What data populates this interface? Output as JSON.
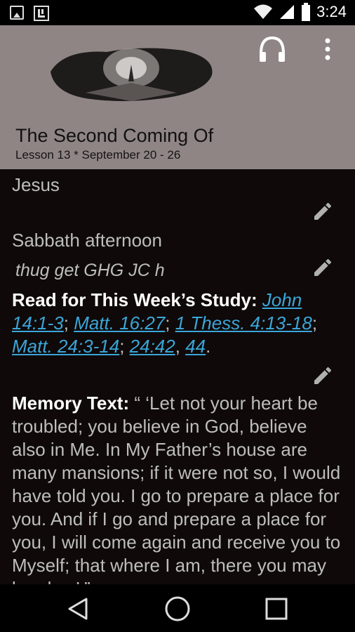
{
  "status": {
    "time": "3:24"
  },
  "header": {
    "title": "The Second Coming Of",
    "subtitle": "Lesson 13 * September 20 - 26"
  },
  "content": {
    "title_cont": "Jesus",
    "section": "Sabbath afternoon",
    "note": "thug get GHG JC h",
    "read": {
      "label": "Read for This Week’s Study:",
      "links": [
        "John 14:1-3",
        "Matt. 16:27",
        "1 Thess. 4:13-18",
        "Matt. 24:3-14",
        "24:42",
        "44"
      ]
    },
    "memory": {
      "label": "Memory Text:",
      "text": " “ ‘Let not your heart be troubled; you believe in God, believe also in Me. In My Father’s house are many mansions; if it were not so, I would have told you. I go to prepare a place for you. And if I go and prepare a place for you, I will come again and receive you to Myself; that where I am, there you may be also.’ ”"
    }
  }
}
